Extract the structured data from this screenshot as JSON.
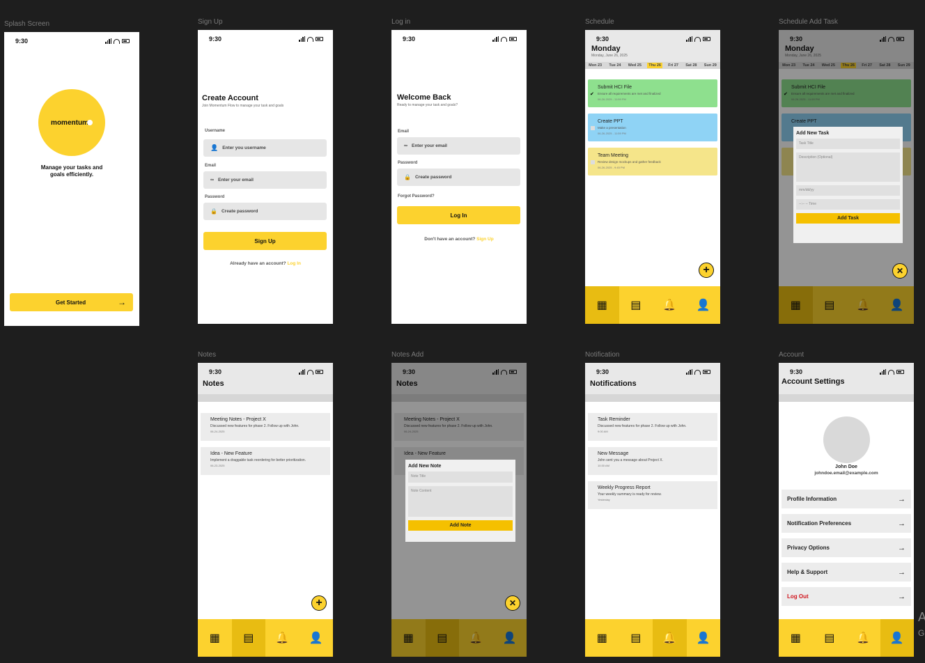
{
  "status_time": "9:30",
  "frames": {
    "splash": "Splash Screen",
    "signup": "Sign Up",
    "login": "Log in",
    "schedule": "Schedule",
    "schedule_add": "Schedule Add Task",
    "notes": "Notes",
    "notes_add": "Notes Add",
    "notification": "Notification",
    "account": "Account"
  },
  "splash": {
    "logo": "momentum",
    "tagline_1": "Manage your tasks and",
    "tagline_2": "goals efficiently.",
    "cta": "Get Started"
  },
  "signup": {
    "title": "Create Account",
    "subtitle": "Join Momentum Flow to manage your task and goals",
    "username_label": "Username",
    "username_ph": "Enter you username",
    "email_label": "Email",
    "email_ph": "Enter your email",
    "password_label": "Password",
    "password_ph": "Create password",
    "button": "Sign Up",
    "footer": "Already have an account?",
    "footer_link": "Log In"
  },
  "login": {
    "title": "Welcome Back",
    "subtitle": "Ready to manage your task and goals?",
    "email_label": "Email",
    "email_ph": "Enter your email",
    "password_label": "Password",
    "password_ph": "Create password",
    "forgot": "Forgot Password?",
    "button": "Log In",
    "footer": "Don't have an account?",
    "footer_link": "Sign Up"
  },
  "schedule": {
    "title": "Monday",
    "date": "Monday, June 26, 2025",
    "days": [
      "Mon 23",
      "Tue 24",
      "Wed 25",
      "Thu 26",
      "Fri 27",
      "Sat 28",
      "Sun 29"
    ],
    "selected_day": "Thu 26",
    "tasks": [
      {
        "title": "Submit HCI File",
        "desc": "Ensure all requirements are met and finalized",
        "date": "06-26-2025 - 11:59 PM",
        "color": "#8ee08e",
        "done": true
      },
      {
        "title": "Create PPT",
        "desc": "Make a presentation",
        "date": "06-26-2025 - 11:59 PM",
        "color": "#8fd3f5",
        "done": false
      },
      {
        "title": "Team Meeting",
        "desc": "Review design mockups and gather feedback",
        "date": "06-26-2025 - 9:45 PM",
        "color": "#f5e58a",
        "done": false
      }
    ]
  },
  "task_modal": {
    "title": "Add New Task",
    "task_title_ph": "Task Title",
    "desc_ph": "Description (Optional)",
    "date_ph": "mm/dd/yy",
    "time_ph": "--:-- -- Time",
    "button": "Add Task"
  },
  "notes": {
    "title": "Notes",
    "items": [
      {
        "title": "Meeting Notes - Project X",
        "desc": "Discussed new features for phase 2. Follow up with John.",
        "date": "06-24-2025"
      },
      {
        "title": "Idea - New Feature",
        "desc": "Implement a draggable task reordering for better prioritization.",
        "date": "06-23-2025"
      }
    ]
  },
  "note_modal": {
    "title": "Add New Note",
    "note_title_ph": "Note Title",
    "content_ph": "Note Content",
    "button": "Add Note"
  },
  "notifications": {
    "title": "Notifications",
    "items": [
      {
        "title": "Task Reminder",
        "desc": "Discussed new features for phase 2. Follow up with John.",
        "time": "9:00 AM"
      },
      {
        "title": "New Message",
        "desc": "John sent you a message about Project X.",
        "time": "10:30 AM"
      },
      {
        "title": "Weekly Progress Report",
        "desc": "Your weekly summary is ready for review.",
        "time": "Yesterday"
      }
    ]
  },
  "account": {
    "title": "Account Settings",
    "name": "John Doe",
    "email": "johndoe.email@example.com",
    "rows": [
      "Profile Information",
      "Notification Preferences",
      "Privacy Options",
      "Help & Support"
    ],
    "logout": "Log Out"
  },
  "colors": {
    "accent": "#fcd22e",
    "accent_dark": "#e8bc12",
    "logout": "#d0141c",
    "canvas": "#1e1e1e"
  },
  "side_text": {
    "big": "A",
    "small": "G"
  }
}
